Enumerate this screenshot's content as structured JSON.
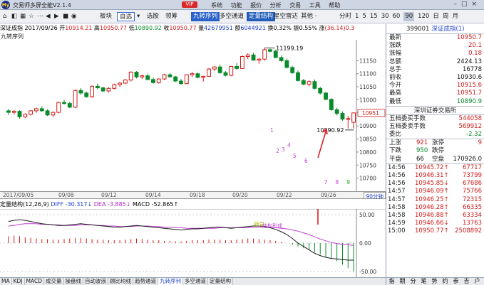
{
  "titlebar": {
    "logo": "Hy",
    "title": "交易师多屏全能V2.1.4",
    "vip": "VIP",
    "menus": [
      "系统",
      "功能",
      "报价",
      "分析",
      "交易",
      "工具",
      "帮助"
    ],
    "window_controls": "–□×"
  },
  "toolbar": {
    "nav": [
      "⌂",
      "◧",
      "▦",
      "☆",
      "⋯",
      "◀",
      "▶",
      "■",
      "◉"
    ],
    "board": "板块",
    "select": "自选",
    "dropdown": "▾",
    "items1": [
      "选股",
      "领筹"
    ],
    "tags": [
      "九转序列",
      "多空通道",
      "定量结构",
      "星空雷达"
    ],
    "other": "其他 ·",
    "periods": [
      "分时",
      "1",
      "5",
      "15",
      "30",
      "60",
      "90",
      "120",
      "日",
      "周",
      "月"
    ],
    "active_period": "90"
  },
  "chart_header": {
    "name": "深证成指",
    "date": "2017/09/26",
    "open_label": "开",
    "open": "10914.21",
    "high_label": "高",
    "high": "10950.77",
    "low_label": "低",
    "low": "10890.92",
    "close_label": "收",
    "close": "10950.77",
    "vol_label": "量",
    "vol": "42679951",
    "amount_label": "额",
    "amount": "6044921",
    "turnover_label": "换",
    "turnover": "0.32%",
    "amp_label": "振",
    "amp": "0.55%",
    "chg_label": "涨",
    "chg": "(36.14)",
    "chg_tail": "0.3",
    "study": "九转序列"
  },
  "annotations": {
    "max_label": "11199.19",
    "min_label": "10890.92",
    "last_price_tag": "10951"
  },
  "axis": {
    "price_ticks": [
      "11150",
      "11100",
      "11050",
      "11000",
      "10950",
      "10900",
      "10850",
      "10800",
      "10750",
      "10700"
    ],
    "dates": [
      "2017/09/05",
      "09/08",
      "09/12",
      "09/14",
      "09/18",
      "09/20",
      "09/22",
      "09/26"
    ],
    "period_tag": "90分钟",
    "ind_ticks": [
      "50.00",
      "0.00",
      "-50.00"
    ]
  },
  "indicator": {
    "name": "定量结构",
    "params": "(12,26,9)",
    "diff_label": "DIFF",
    "diff": "-30.317↓",
    "dea_label": "DEA",
    "dea": "-3.885↓",
    "macd_label": "MACD",
    "macd": "-52.865↑",
    "turn_label": "转弱",
    "structure_label": "结构形成"
  },
  "bottom_tabs": [
    "MA",
    "KDJ",
    "MACD",
    "成交量",
    "操盘线",
    "自动波浪",
    "顾比均线",
    "趋势通道",
    "九转序列",
    "多空通道",
    "定量结构"
  ],
  "active_bottom_tab": "九转序列",
  "colors": {
    "up": "#d21a1a",
    "down": "#0a8a2a",
    "blue": "#1a3ec9"
  },
  "right_panel": {
    "code": "399001",
    "name": "深证成指(1)",
    "quote": [
      {
        "k": "最新",
        "v": "10950.7",
        "c": "r"
      },
      {
        "k": "涨跌",
        "v": "20.1",
        "c": "r"
      },
      {
        "k": "涨幅",
        "v": "0.18",
        "c": "r"
      },
      {
        "k": "总额",
        "v": "2424.13",
        "c": "k"
      },
      {
        "k": "总手",
        "v": "16778",
        "c": "k"
      },
      {
        "k": "前收",
        "v": "10930.6",
        "c": "k"
      },
      {
        "k": "今开",
        "v": "10915.6",
        "c": "r"
      },
      {
        "k": "最高",
        "v": "10951.7",
        "c": "r"
      },
      {
        "k": "最低",
        "v": "10890.9",
        "c": "g"
      }
    ],
    "exchange": "深圳证券交易所",
    "book": [
      {
        "k": "五档委买手数",
        "v": "544058",
        "c": "r"
      },
      {
        "k": "五档委卖手数",
        "v": "569912",
        "c": "r"
      },
      {
        "k": "委比",
        "v": "-2.32",
        "c": "g"
      }
    ],
    "breadth": [
      {
        "k1": "上涨",
        "v1": "921",
        "k2": "涨停",
        "v2": "9",
        "c": "r"
      },
      {
        "k1": "下跌",
        "v1": "950",
        "k2": "跌停",
        "v2": "",
        "c": "g"
      },
      {
        "k1": "平盘",
        "v1": "66",
        "k2": "空盘",
        "v2": "170926.0",
        "c": "k"
      }
    ],
    "ticks": [
      {
        "t": "14:56",
        "p": "10945.72↑",
        "q": "67717"
      },
      {
        "t": "14:56",
        "p": "10946.31↑",
        "q": "73799"
      },
      {
        "t": "14:56",
        "p": "10945.85↓",
        "q": "67686"
      },
      {
        "t": "14:57",
        "p": "10946.09↑",
        "q": "75766"
      },
      {
        "t": "14:57",
        "p": "10946.25↑",
        "q": "72315"
      },
      {
        "t": "14:58",
        "p": "10946.28↑",
        "q": "66335"
      },
      {
        "t": "14:58",
        "p": "10946.88↑",
        "q": "63334"
      },
      {
        "t": "14:59",
        "p": "10946.66↓",
        "q": "13763"
      },
      {
        "t": "15:00",
        "p": "10950.77↑",
        "q": "2508892"
      }
    ],
    "tabs": [
      "指",
      "期",
      "分",
      "笔",
      "势",
      "约",
      "参",
      "吉",
      "户"
    ]
  },
  "chart_data": {
    "type": "candlestick",
    "title": "深证成指 2017/09/26",
    "ylim": [
      10650,
      11230
    ],
    "x_dates": [
      "2017/09/05",
      "09/08",
      "09/12",
      "09/14",
      "09/18",
      "09/20",
      "09/22",
      "09/26"
    ],
    "candles": [
      [
        10958,
        10965,
        10942,
        10952
      ],
      [
        10952,
        10962,
        10944,
        10956
      ],
      [
        10956,
        10960,
        10928,
        10935
      ],
      [
        10935,
        10948,
        10930,
        10945
      ],
      [
        10945,
        10960,
        10940,
        10958
      ],
      [
        10958,
        10970,
        10950,
        10966
      ],
      [
        10966,
        10975,
        10954,
        10958
      ],
      [
        10958,
        10964,
        10938,
        10942
      ],
      [
        10942,
        10955,
        10935,
        10952
      ],
      [
        10952,
        10992,
        10948,
        10990
      ],
      [
        10990,
        11000,
        10982,
        10986
      ],
      [
        10986,
        10992,
        10968,
        10972
      ],
      [
        10972,
        11040,
        10968,
        11036
      ],
      [
        11036,
        11045,
        11020,
        11026
      ],
      [
        11026,
        11032,
        11008,
        11012
      ],
      [
        11012,
        11055,
        11008,
        11052
      ],
      [
        11052,
        11062,
        11040,
        11046
      ],
      [
        11046,
        11050,
        11030,
        11034
      ],
      [
        11034,
        11048,
        11028,
        11044
      ],
      [
        11044,
        11062,
        11040,
        11058
      ],
      [
        11058,
        11068,
        11050,
        11064
      ],
      [
        11064,
        11080,
        11060,
        11076
      ],
      [
        11076,
        11110,
        11070,
        11106
      ],
      [
        11106,
        11110,
        11082,
        11088
      ],
      [
        11088,
        11096,
        11080,
        11092
      ],
      [
        11092,
        11100,
        11075,
        11078
      ],
      [
        11078,
        11085,
        11062,
        11066
      ],
      [
        11066,
        11082,
        11062,
        11080
      ],
      [
        11080,
        11100,
        11076,
        11096
      ],
      [
        11096,
        11102,
        11085,
        11088
      ],
      [
        11088,
        11092,
        11068,
        11072
      ],
      [
        11072,
        11080,
        11058,
        11062
      ],
      [
        11062,
        11098,
        11060,
        11096
      ],
      [
        11096,
        11106,
        11088,
        11100
      ],
      [
        11100,
        11104,
        11082,
        11086
      ],
      [
        11086,
        11092,
        11070,
        11090
      ],
      [
        11090,
        11122,
        11088,
        11118
      ],
      [
        11118,
        11130,
        11110,
        11126
      ],
      [
        11126,
        11135,
        11100,
        11104
      ],
      [
        11104,
        11110,
        11090,
        11094
      ],
      [
        11094,
        11130,
        11090,
        11128
      ],
      [
        11128,
        11140,
        11116,
        11120
      ],
      [
        11120,
        11170,
        11118,
        11166
      ],
      [
        11166,
        11178,
        11156,
        11172
      ],
      [
        11172,
        11180,
        11150,
        11152
      ],
      [
        11152,
        11160,
        11138,
        11156
      ],
      [
        11156,
        11199,
        11150,
        11192
      ],
      [
        11192,
        11196,
        11182,
        11186
      ],
      [
        11186,
        11192,
        11160,
        11162
      ],
      [
        11162,
        11170,
        11145,
        11150
      ],
      [
        11150,
        11158,
        11120,
        11124
      ],
      [
        11124,
        11130,
        11100,
        11104
      ],
      [
        11104,
        11112,
        11070,
        11074
      ],
      [
        11074,
        11080,
        11056,
        11060
      ],
      [
        11060,
        11075,
        11052,
        11070
      ],
      [
        11070,
        11078,
        11040,
        11044
      ],
      [
        11044,
        11050,
        11020,
        11026
      ],
      [
        11026,
        11030,
        10998,
        11002
      ],
      [
        11002,
        11006,
        10958,
        10962
      ],
      [
        10962,
        10970,
        10940,
        10948
      ],
      [
        10948,
        10956,
        10920,
        10926
      ],
      [
        10926,
        10938,
        10890,
        10928
      ],
      [
        10914,
        10951,
        10890,
        10950
      ]
    ],
    "nine_turn_labels": [
      "1",
      "2",
      "3",
      "4",
      "5",
      "6",
      "7",
      "8",
      "9"
    ],
    "macd": {
      "hist": [
        12,
        13,
        12,
        10,
        9,
        8,
        7,
        7,
        6,
        6,
        7,
        8,
        9,
        9,
        8,
        7,
        6,
        6,
        5,
        5,
        5,
        6,
        7,
        8,
        7,
        6,
        5,
        5,
        4,
        4,
        3,
        3,
        4,
        5,
        5,
        5,
        6,
        6,
        6,
        5,
        5,
        6,
        7,
        8,
        8,
        7,
        6,
        5,
        4,
        2,
        0,
        -3,
        -6,
        -9,
        -12,
        -16,
        -20,
        -24,
        -28,
        -32,
        -38,
        -44,
        -50
      ],
      "diff": [
        38,
        40,
        41,
        40,
        38,
        36,
        34,
        33,
        32,
        31,
        31,
        32,
        33,
        34,
        33,
        32,
        31,
        30,
        29,
        28,
        28,
        29,
        30,
        31,
        30,
        29,
        28,
        27,
        26,
        25,
        24,
        23,
        24,
        25,
        25,
        26,
        27,
        28,
        28,
        27,
        26,
        27,
        28,
        29,
        30,
        30,
        29,
        27,
        24,
        20,
        15,
        8,
        0,
        -6,
        -12,
        -18,
        -22,
        -25,
        -27,
        -28,
        -29,
        -30,
        -30
      ],
      "dea": [
        30,
        31,
        33,
        34,
        34,
        34,
        33,
        33,
        32,
        32,
        31,
        31,
        31,
        32,
        32,
        32,
        31,
        31,
        30,
        30,
        29,
        29,
        29,
        30,
        30,
        30,
        29,
        29,
        28,
        28,
        27,
        27,
        26,
        26,
        26,
        26,
        26,
        26,
        27,
        27,
        27,
        27,
        27,
        27,
        28,
        28,
        28,
        28,
        27,
        26,
        25,
        23,
        21,
        18,
        15,
        11,
        7,
        4,
        1,
        -1,
        -2,
        -3,
        -4
      ],
      "ylim": [
        -60,
        60
      ]
    }
  }
}
